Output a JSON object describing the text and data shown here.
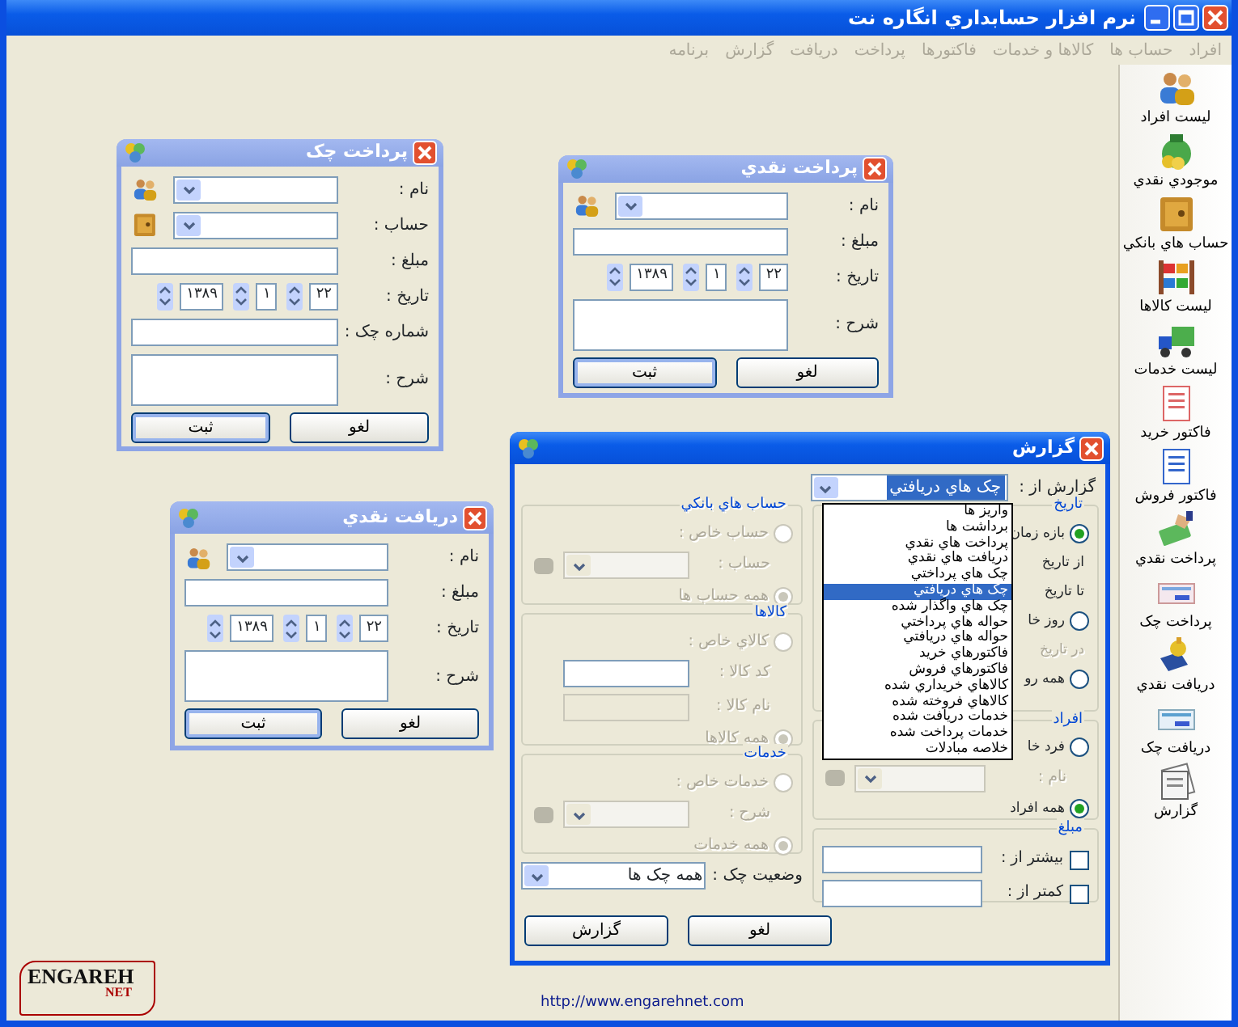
{
  "window": {
    "title": "نرم افزار حسابداري انگاره نت"
  },
  "menu": [
    {
      "label": "افراد",
      "disabled": true
    },
    {
      "label": "حساب ها",
      "disabled": true
    },
    {
      "label": "كالاها و خدمات",
      "disabled": true
    },
    {
      "label": "فاكتورها",
      "disabled": true
    },
    {
      "label": "پرداخت",
      "disabled": true
    },
    {
      "label": "دريافت",
      "disabled": true
    },
    {
      "label": "گزارش",
      "disabled": true
    },
    {
      "label": "برنامه",
      "disabled": true
    }
  ],
  "sidebar": {
    "items": [
      {
        "label": "ليست افراد"
      },
      {
        "label": "موجودي نقدي"
      },
      {
        "label": "حساب هاي بانكي"
      },
      {
        "label": "ليست كالاها"
      },
      {
        "label": "ليست خدمات"
      },
      {
        "label": "فاكتور خريد"
      },
      {
        "label": "فاكتور فروش"
      },
      {
        "label": "پرداخت نقدي"
      },
      {
        "label": "پرداخت چک"
      },
      {
        "label": "دريافت نقدي"
      },
      {
        "label": "دريافت چک"
      },
      {
        "label": "گزارش"
      }
    ]
  },
  "dialogs": [
    {
      "title": "پرداخت چک",
      "fields": [
        {
          "kind": "combo",
          "label": "نام :"
        },
        {
          "kind": "combo",
          "label": "حساب :"
        },
        {
          "kind": "text",
          "label": "مبلغ :"
        },
        {
          "kind": "date",
          "label": "تاريخ :",
          "values": [
            "۲۲",
            "۱",
            "۱۳۸۹"
          ]
        },
        {
          "kind": "text",
          "label": "شماره چک :"
        },
        {
          "kind": "memo",
          "label": "شرح :"
        }
      ],
      "buttons": [
        {
          "label": "لغو",
          "default": false
        },
        {
          "label": "ثبت",
          "default": true
        }
      ]
    },
    {
      "title": "پرداخت نقدي",
      "fields": [
        {
          "kind": "combo",
          "label": "نام :"
        },
        {
          "kind": "text",
          "label": "مبلغ :"
        },
        {
          "kind": "date",
          "label": "تاريخ :",
          "values": [
            "۲۲",
            "۱",
            "۱۳۸۹"
          ]
        },
        {
          "kind": "memo",
          "label": "شرح :"
        }
      ],
      "buttons": [
        {
          "label": "لغو",
          "default": false
        },
        {
          "label": "ثبت",
          "default": true
        }
      ]
    },
    {
      "title": "دريافت نقدي",
      "fields": [
        {
          "kind": "combo",
          "label": "نام :"
        },
        {
          "kind": "text",
          "label": "مبلغ :"
        },
        {
          "kind": "date",
          "label": "تاريخ :",
          "values": [
            "۲۲",
            "۱",
            "۱۳۸۹"
          ]
        },
        {
          "kind": "memo",
          "label": "شرح :"
        }
      ],
      "buttons": [
        {
          "label": "لغو",
          "default": false
        },
        {
          "label": "ثبت",
          "default": true
        }
      ]
    }
  ],
  "report": {
    "title": "گزارش",
    "source": {
      "label": "گزارش از :",
      "value": "چک هاي دريافتي",
      "options": [
        {
          "label": "واريز ها",
          "selected": false
        },
        {
          "label": "برداشت ها",
          "selected": false
        },
        {
          "label": "پرداخت هاي نقدي",
          "selected": false
        },
        {
          "label": "دريافت هاي نقدي",
          "selected": false
        },
        {
          "label": "چک هاي پرداختي",
          "selected": false
        },
        {
          "label": "چک هاي دريافتي",
          "selected": true
        },
        {
          "label": "چک هاي واگذار شده",
          "selected": false
        },
        {
          "label": "حواله هاي پرداختي",
          "selected": false
        },
        {
          "label": "حواله هاي دريافتي",
          "selected": false
        },
        {
          "label": "فاكتورهاي خريد",
          "selected": false
        },
        {
          "label": "فاكتورهاي فروش",
          "selected": false
        },
        {
          "label": "كالاهاي خريداري شده",
          "selected": false
        },
        {
          "label": "كالاهاي فروخته شده",
          "selected": false
        },
        {
          "label": "خدمات دريافت شده",
          "selected": false
        },
        {
          "label": "خدمات پرداخت شده",
          "selected": false
        },
        {
          "label": "خلاصه مبادلات",
          "selected": false
        }
      ]
    },
    "right_groups": [
      {
        "title": "تاريخ",
        "disabled": false,
        "items": [
          {
            "kind": "radio",
            "label": "بازه زمان",
            "checked": true
          },
          {
            "kind": "label",
            "label": "از تاريخ",
            "disabled": false
          },
          {
            "kind": "label",
            "label": "تا تاريخ",
            "disabled": false
          },
          {
            "kind": "radio",
            "label": "روز خا",
            "checked": false
          },
          {
            "kind": "label",
            "label": "در تاريخ",
            "disabled": true
          },
          {
            "kind": "radio",
            "label": "همه رو",
            "checked": false
          }
        ]
      },
      {
        "title": "افراد",
        "disabled": false,
        "items": [
          {
            "kind": "radio",
            "label": "فرد خا",
            "checked": false
          },
          {
            "kind": "combo",
            "label": "نام :",
            "disabled": true
          },
          {
            "kind": "radio",
            "label": "همه افراد",
            "checked": true
          }
        ]
      },
      {
        "title": "مبلغ",
        "disabled": false,
        "items": [
          {
            "kind": "check",
            "label": "بيشتر از :",
            "checked": false
          },
          {
            "kind": "check",
            "label": "كمتر از :",
            "checked": false
          }
        ]
      }
    ],
    "left_groups": [
      {
        "title": "حساب هاي بانكي",
        "disabled": true,
        "items": [
          {
            "kind": "radio",
            "label": "حساب خاص :",
            "checked": false
          },
          {
            "kind": "combo",
            "label": "حساب :",
            "disabled": true
          },
          {
            "kind": "radio",
            "label": "همه حساب ها",
            "checked": true
          }
        ]
      },
      {
        "title": "كالاها",
        "disabled": true,
        "items": [
          {
            "kind": "radio",
            "label": "كالاي خاص :",
            "checked": false
          },
          {
            "kind": "text",
            "label": "كد كالا :",
            "disabled": false
          },
          {
            "kind": "text",
            "label": "نام كالا :",
            "disabled": true
          },
          {
            "kind": "radio",
            "label": "همه كالاها",
            "checked": true
          }
        ]
      },
      {
        "title": "خدمات",
        "disabled": true,
        "items": [
          {
            "kind": "radio",
            "label": "خدمات خاص :",
            "checked": false
          },
          {
            "kind": "combo",
            "label": "شرح :",
            "disabled": true
          },
          {
            "kind": "radio",
            "label": "همه خدمات",
            "checked": true
          }
        ]
      }
    ],
    "status": {
      "label": "وضعيت چک :",
      "value": "همه چک ها"
    },
    "buttons": [
      {
        "label": "لغو",
        "default": false
      },
      {
        "label": "گزارش",
        "default": false
      }
    ]
  },
  "footer": {
    "link": "http://www.engarehnet.com",
    "logo": {
      "text": "ENGAREH",
      "subtext": "NET"
    }
  }
}
